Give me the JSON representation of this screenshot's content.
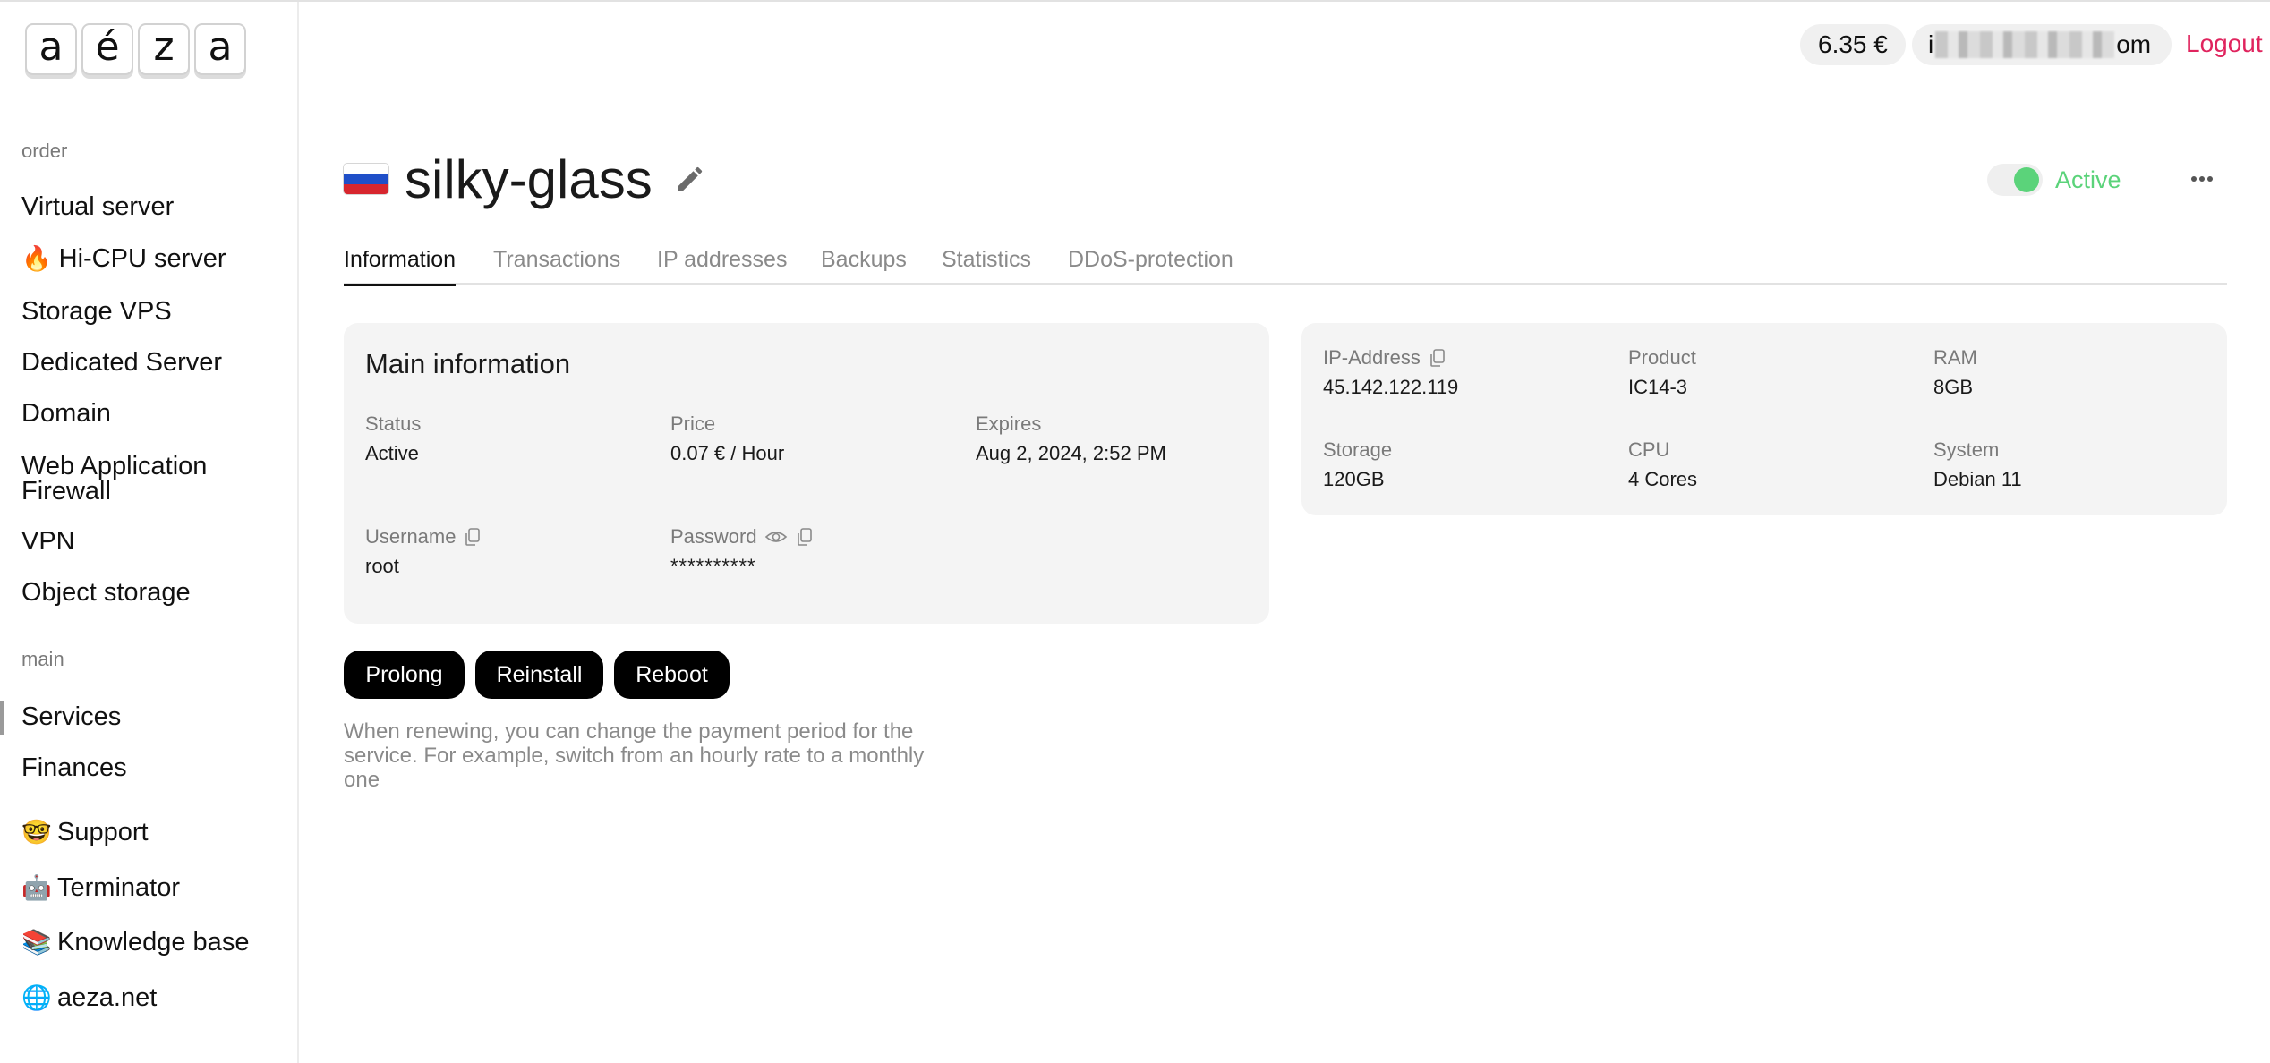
{
  "logo": {
    "keys": [
      "a",
      "é",
      "z",
      "a"
    ]
  },
  "sidebar": {
    "order_heading": "order",
    "order_items": [
      {
        "emoji": "",
        "label": "Virtual server"
      },
      {
        "emoji": "🔥",
        "label": "Hi-CPU server"
      },
      {
        "emoji": "",
        "label": "Storage VPS"
      },
      {
        "emoji": "",
        "label": "Dedicated Server"
      },
      {
        "emoji": "",
        "label": "Domain"
      },
      {
        "emoji": "",
        "label": "Web Application Firewall"
      },
      {
        "emoji": "",
        "label": "VPN"
      },
      {
        "emoji": "",
        "label": "Object storage"
      }
    ],
    "main_heading": "main",
    "main_items": [
      {
        "emoji": "",
        "label": "Services",
        "active": true
      },
      {
        "emoji": "",
        "label": "Finances"
      }
    ],
    "extra_items": [
      {
        "emoji": "🤓",
        "label": "Support"
      },
      {
        "emoji": "🤖",
        "label": "Terminator"
      },
      {
        "emoji": "📚",
        "label": "Knowledge base"
      },
      {
        "emoji": "🌐",
        "label": "aeza.net"
      }
    ]
  },
  "header": {
    "balance": "6.35 €",
    "email_prefix": "i",
    "email_suffix": "om",
    "logout_label": "Logout"
  },
  "server": {
    "flag": "russia-flag",
    "name": "silky-glass",
    "status_label": "Active",
    "status_on": true
  },
  "tabs": [
    {
      "label": "Information",
      "active": true
    },
    {
      "label": "Transactions"
    },
    {
      "label": "IP addresses"
    },
    {
      "label": "Backups"
    },
    {
      "label": "Statistics"
    },
    {
      "label": "DDoS-protection"
    }
  ],
  "main_info": {
    "title": "Main information",
    "status_label": "Status",
    "status_value": "Active",
    "price_label": "Price",
    "price_value": "0.07 € / Hour",
    "expires_label": "Expires",
    "expires_value": "Aug 2, 2024, 2:52 PM",
    "username_label": "Username",
    "username_value": "root",
    "password_label": "Password",
    "password_value": "**********"
  },
  "specs": {
    "ip_label": "IP-Address",
    "ip_value": "45.142.122.119",
    "product_label": "Product",
    "product_value": "IC14-3",
    "ram_label": "RAM",
    "ram_value": "8GB",
    "storage_label": "Storage",
    "storage_value": "120GB",
    "cpu_label": "CPU",
    "cpu_value": "4 Cores",
    "system_label": "System",
    "system_value": "Debian 11"
  },
  "actions": {
    "prolong": "Prolong",
    "reinstall": "Reinstall",
    "reboot": "Reboot",
    "hint": "When renewing, you can change the payment period for the service. For example, switch from an hourly rate to a monthly one"
  },
  "colors": {
    "active_green": "#5bd37a",
    "logout_red": "#e0245e",
    "card_bg": "#f4f4f4"
  }
}
